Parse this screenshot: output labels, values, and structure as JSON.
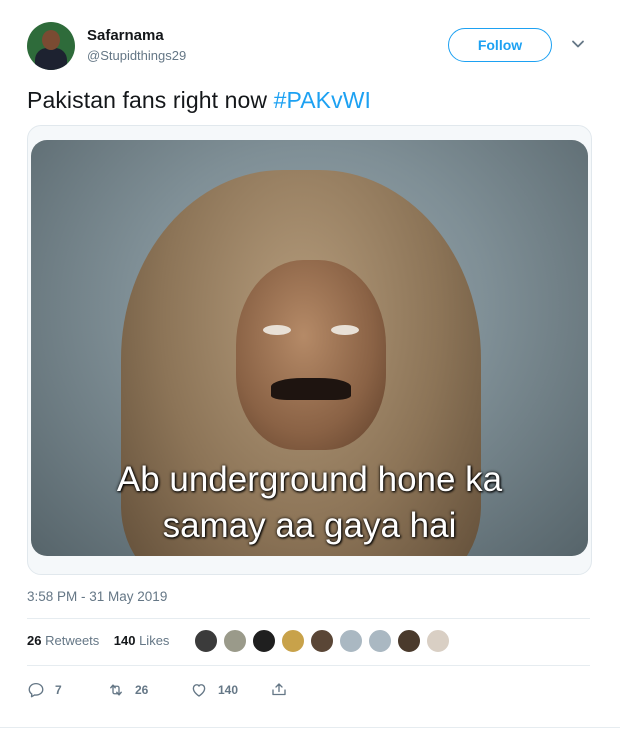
{
  "tweet": {
    "author_name": "Safarnama",
    "author_handle": "@Stupidthings29",
    "follow_label": "Follow",
    "text_prefix": "Pakistan fans right now ",
    "hashtag": "#PAKvWI",
    "image_caption_line1": "Ab underground hone ka",
    "image_caption_line2": "samay aa gaya hai",
    "timestamp": "3:58 PM - 31 May 2019",
    "retweets_count": "26",
    "retweets_label": "Retweets",
    "likes_count": "140",
    "likes_label": "Likes",
    "reply_count": "7",
    "retweet_action_count": "26",
    "like_action_count": "140"
  },
  "colors": {
    "accent": "#1da1f2",
    "secondary_text": "#657786",
    "primary_text": "#14171a",
    "divider": "#e6ecf0"
  },
  "icons": {
    "caret": "chevron-down-icon",
    "reply": "reply-icon",
    "retweet": "retweet-icon",
    "like": "heart-icon",
    "share": "share-icon"
  }
}
